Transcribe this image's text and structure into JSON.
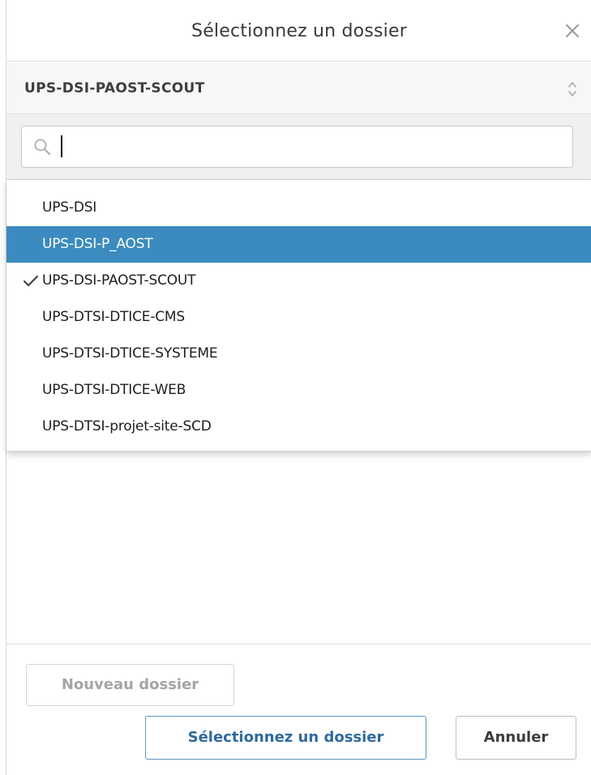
{
  "dialog": {
    "title": "Sélectionnez un dossier"
  },
  "folder_select": {
    "selected_value": "UPS-DSI-PAOST-SCOUT"
  },
  "search": {
    "value": "",
    "placeholder": ""
  },
  "dropdown": {
    "items": [
      {
        "label": "UPS-DSI",
        "checked": false,
        "highlighted": false
      },
      {
        "label": "UPS-DSI-P_AOST",
        "checked": false,
        "highlighted": true
      },
      {
        "label": "UPS-DSI-PAOST-SCOUT",
        "checked": true,
        "highlighted": false
      },
      {
        "label": "UPS-DTSI-DTICE-CMS",
        "checked": false,
        "highlighted": false
      },
      {
        "label": "UPS-DTSI-DTICE-SYSTEME",
        "checked": false,
        "highlighted": false
      },
      {
        "label": "UPS-DTSI-DTICE-WEB",
        "checked": false,
        "highlighted": false
      },
      {
        "label": "UPS-DTSI-projet-site-SCD",
        "checked": false,
        "highlighted": false
      }
    ]
  },
  "footer": {
    "new_folder_label": "Nouveau dossier",
    "select_label": "Sélectionnez un dossier",
    "cancel_label": "Annuler"
  },
  "colors": {
    "highlight": "#3b8bc0",
    "primary_button_text": "#2e6aa0",
    "primary_button_border": "#5a97c4",
    "disabled_text": "#a5a5a5"
  },
  "icons": {
    "close": "close-icon",
    "updown": "updown-chevron-icon",
    "search": "search-icon",
    "check": "check-icon"
  }
}
